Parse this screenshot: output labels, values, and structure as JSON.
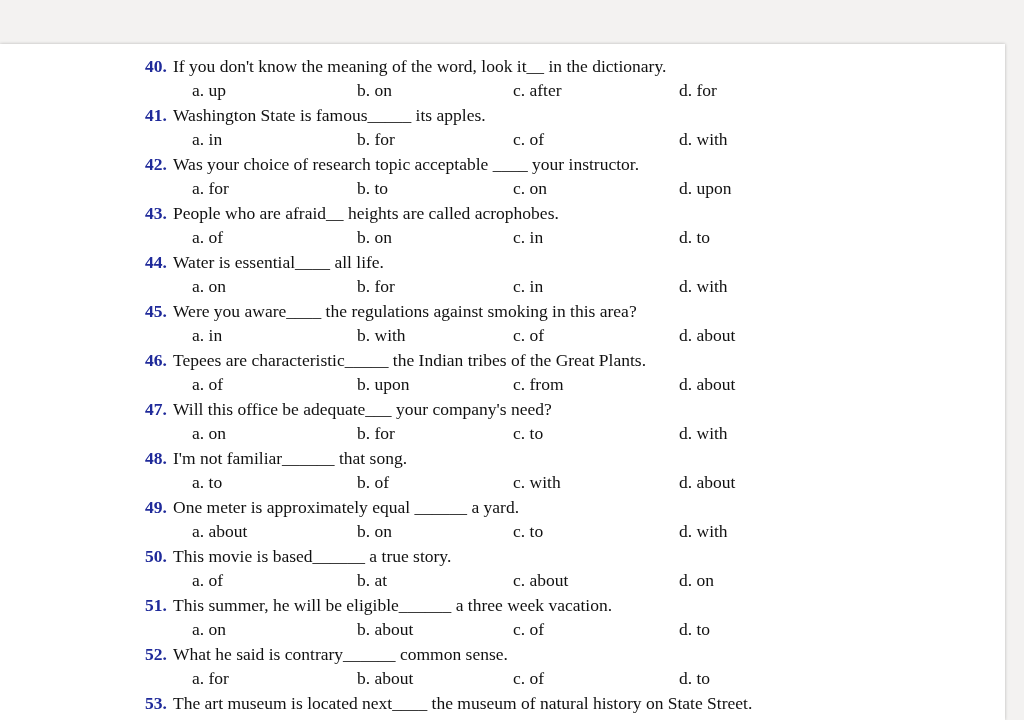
{
  "questions": [
    {
      "number": "40.",
      "text": "If you don't know the meaning of the word, look it__ in the dictionary.",
      "options": [
        "a. up",
        "b. on",
        "c. after",
        "d. for"
      ]
    },
    {
      "number": "41.",
      "text": "Washington State is famous_____ its apples.",
      "options": [
        "a. in",
        "b. for",
        "c. of",
        "d. with"
      ]
    },
    {
      "number": "42.",
      "text": "Was your choice of research topic acceptable ____ your instructor.",
      "options": [
        "a. for",
        "b. to",
        "c. on",
        "d. upon"
      ]
    },
    {
      "number": "43.",
      "text": "People who are afraid__ heights are called acrophobes.",
      "options": [
        "a. of",
        "b. on",
        "c. in",
        "d. to"
      ]
    },
    {
      "number": "44.",
      "text": "Water is essential____ all life.",
      "options": [
        "a. on",
        "b. for",
        "c. in",
        "d. with"
      ]
    },
    {
      "number": "45.",
      "text": "Were you aware____ the regulations against smoking in this area?",
      "options": [
        "a. in",
        "b. with",
        "c. of",
        "d. about"
      ]
    },
    {
      "number": "46.",
      "text": "Tepees are characteristic_____ the Indian tribes of the Great Plants.",
      "options": [
        "a. of",
        "b. upon",
        "c. from",
        "d. about"
      ]
    },
    {
      "number": "47.",
      "text": "Will this office be adequate___ your company's need?",
      "options": [
        "a. on",
        "b. for",
        "c. to",
        "d. with"
      ]
    },
    {
      "number": "48.",
      "text": "I'm not familiar______ that song.",
      "options": [
        "a. to",
        "b. of",
        "c. with",
        "d. about"
      ]
    },
    {
      "number": "49.",
      "text": "One meter is approximately equal ______ a yard.",
      "options": [
        "a. about",
        "b. on",
        "c. to",
        "d. with"
      ]
    },
    {
      "number": "50.",
      "text": "This movie is based______ a true story.",
      "options": [
        "a. of",
        "b. at",
        "c. about",
        "d. on"
      ]
    },
    {
      "number": "51.",
      "text": "This summer, he will be eligible______ a three week vacation.",
      "options": [
        "a. on",
        "b. about",
        "c. of",
        "d. to"
      ]
    },
    {
      "number": "52.",
      "text": "What he said is contrary______ common sense.",
      "options": [
        "a. for",
        "b. about",
        "c. of",
        "d. to"
      ]
    },
    {
      "number": "53.",
      "text": "The art museum is located next____ the museum of natural history on State Street."
    }
  ]
}
